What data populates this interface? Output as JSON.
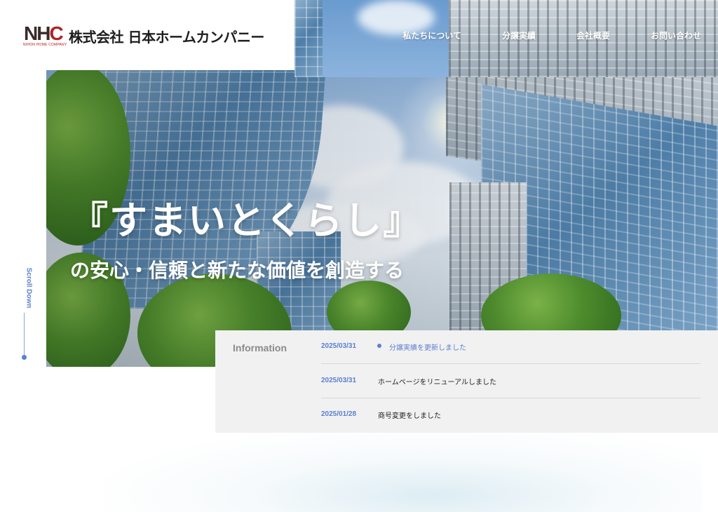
{
  "header": {
    "logo_mark": "NHC",
    "logo_sub": "NIHON HOME COMPANY",
    "company_name": "株式会社 日本ホームカンパニー",
    "nav": [
      {
        "label": "私たちについて"
      },
      {
        "label": "分譲実績"
      },
      {
        "label": "会社概要"
      },
      {
        "label": "お問い合わせ"
      }
    ]
  },
  "hero": {
    "headline": "『すまいとくらし』",
    "subheadline": "の安心・信頼と新たな価値を創造する"
  },
  "scroll": {
    "label": "Scroll Down"
  },
  "information": {
    "title": "Information",
    "items": [
      {
        "date": "2025/03/31",
        "text": "分譲実績を更新しました",
        "active": true
      },
      {
        "date": "2025/03/31",
        "text": "ホームページをリニューアルしました",
        "active": false
      },
      {
        "date": "2025/01/28",
        "text": "商号変更をしました",
        "active": false
      }
    ]
  },
  "colors": {
    "accent": "#5b7fd0",
    "brand_red": "#b22222"
  }
}
